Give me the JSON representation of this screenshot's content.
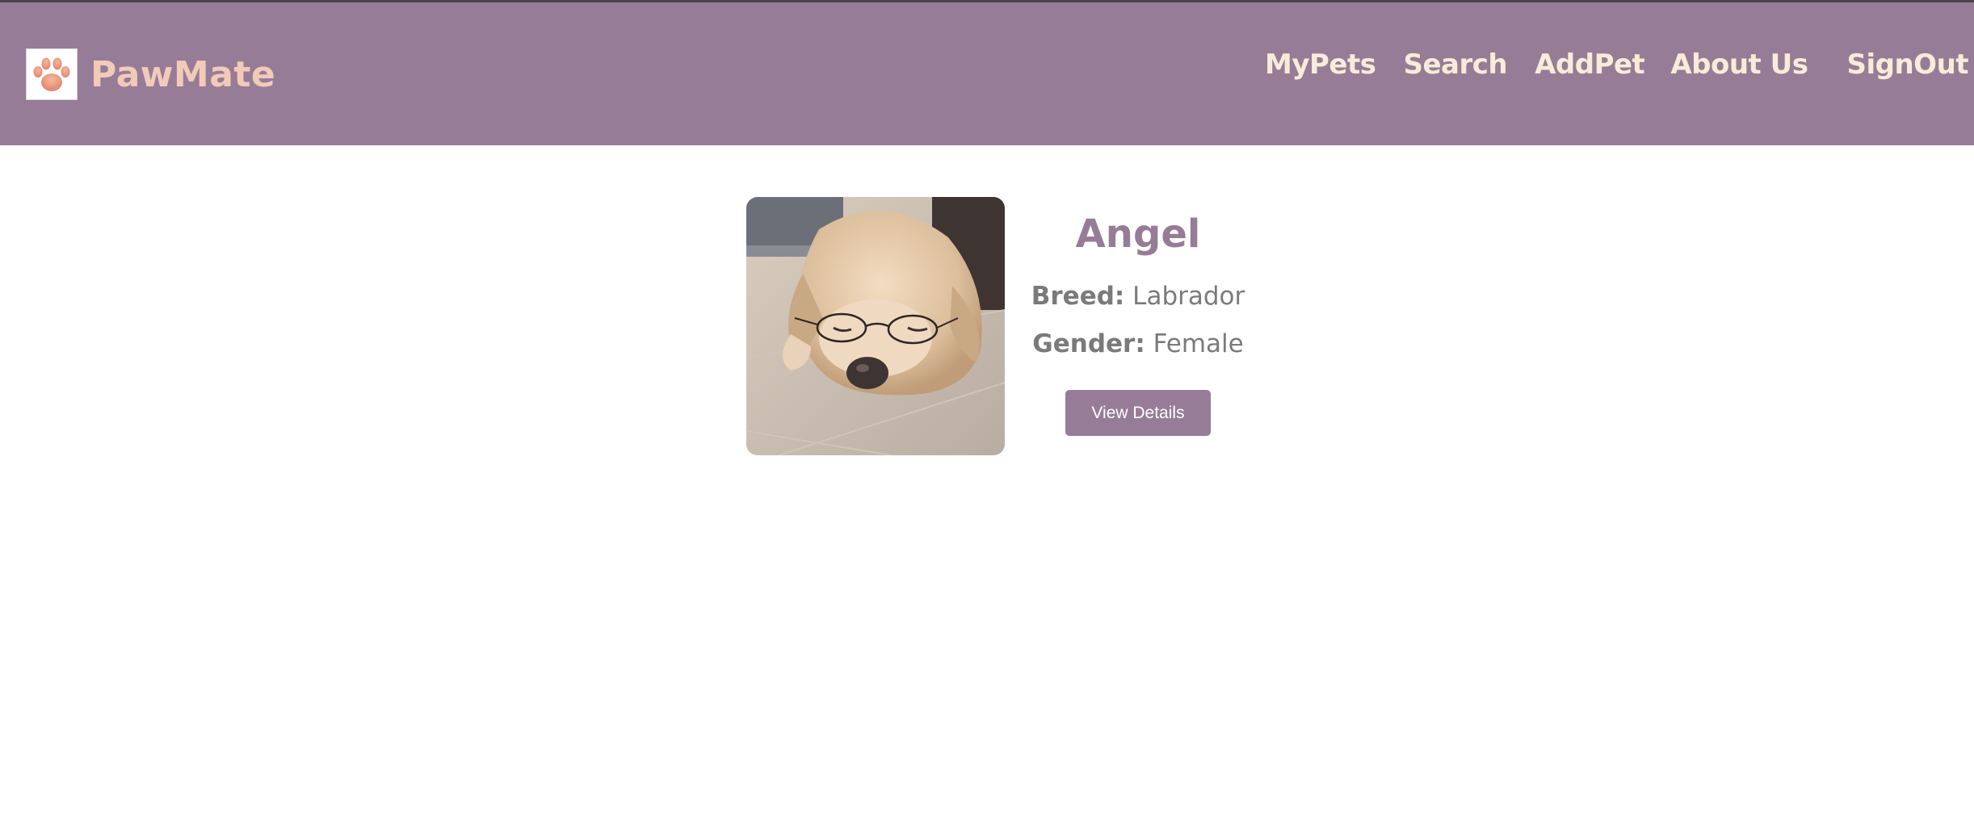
{
  "header": {
    "brand": "PawMate",
    "logo_icon": "paw-icon",
    "nav": [
      {
        "label": "MyPets"
      },
      {
        "label": "Search"
      },
      {
        "label": "AddPet"
      },
      {
        "label": "About Us"
      },
      {
        "label": "SignOut"
      }
    ]
  },
  "pet": {
    "name": "Angel",
    "breed_label": "Breed:",
    "breed": "Labrador",
    "gender_label": "Gender:",
    "gender": "Female",
    "photo_alt": "labrador-with-glasses-photo",
    "button_label": "View Details"
  },
  "colors": {
    "header_bg": "#977c97",
    "brand_text": "#f2cbb8",
    "nav_text": "#f8ecd8",
    "accent": "#977c97",
    "body_text": "#7a7a7a"
  }
}
